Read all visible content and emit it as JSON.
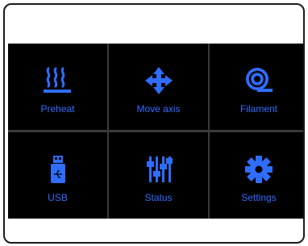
{
  "menu": {
    "tiles": [
      {
        "label": "Preheat",
        "icon": "heat-waves-icon"
      },
      {
        "label": "Move axis",
        "icon": "move-arrows-icon"
      },
      {
        "label": "Filament",
        "icon": "filament-spool-icon"
      },
      {
        "label": "USB",
        "icon": "usb-drive-icon"
      },
      {
        "label": "Status",
        "icon": "status-sliders-icon"
      },
      {
        "label": "Settings",
        "icon": "gear-icon"
      }
    ]
  },
  "colors": {
    "accent": "#2f6dff",
    "tile_background": "#000000",
    "grid_lines": "#3a3a3a",
    "frame": "#ffffff"
  }
}
